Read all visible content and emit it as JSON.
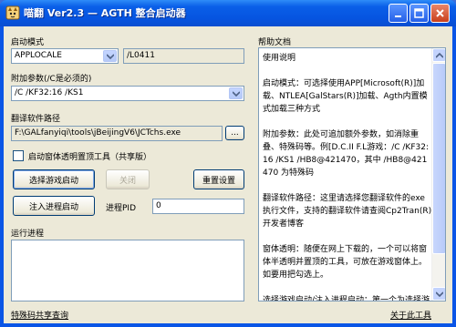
{
  "window": {
    "title": "喵翻 Ver2.3 — AGTH 整合启动器"
  },
  "left": {
    "launch_mode_label": "启动模式",
    "launch_mode_value": "APPLOCALE",
    "launch_mode_extra": "/L0411",
    "extra_params_label": "附加参数(/C是必须的)",
    "extra_params_value": "/C /KF32:16 /KS1",
    "translator_path_label": "翻译软件路径",
    "translator_path_value": "F:\\GALfanyiqi\\tools\\jBeijingV6\\JCTchs.exe",
    "browse_label": "...",
    "transparency_checkbox_label": "启动窗体透明置顶工具（共享版）",
    "select_game_button": "选择游戏启动",
    "close_button": "关闭",
    "reset_button": "重置设置",
    "inject_button": "注入进程启动",
    "pid_label": "进程PID",
    "pid_value": "0",
    "running_process_label": "运行进程",
    "special_code_link": "特殊码共享查询"
  },
  "right": {
    "help_label": "帮助文档",
    "help_text": "使用说明\n\n启动模式：可选择使用APP[Microsoft(R)]加载、NTLEA[GalStars(R)]加载、Agth内置模式加载三种方式\n\n附加参数：此处可追加额外参数，如消除重叠、特殊码等。例[D.C.II F.L游戏：/C /KF32:16 /KS1 /HB8@421470，其中 /HB8@421470 为特殊码\n\n翻译软件路径：这里请选择您翻译软件的exe执行文件，支持的翻译软件请查阅Cp2Tran(R)开发者博客\n\n窗体透明：随便在网上下载的，一个可以将窗体半透明并置顶的工具，可放在游戏窗体上。如要用把勾选上。\n\n选择游戏启动/注入进程启动：第一个为选择游戏直接启动；第二个为注入启动，找到游戏程序的PID数字（关于PID问题",
    "about_link": "关于此工具"
  }
}
